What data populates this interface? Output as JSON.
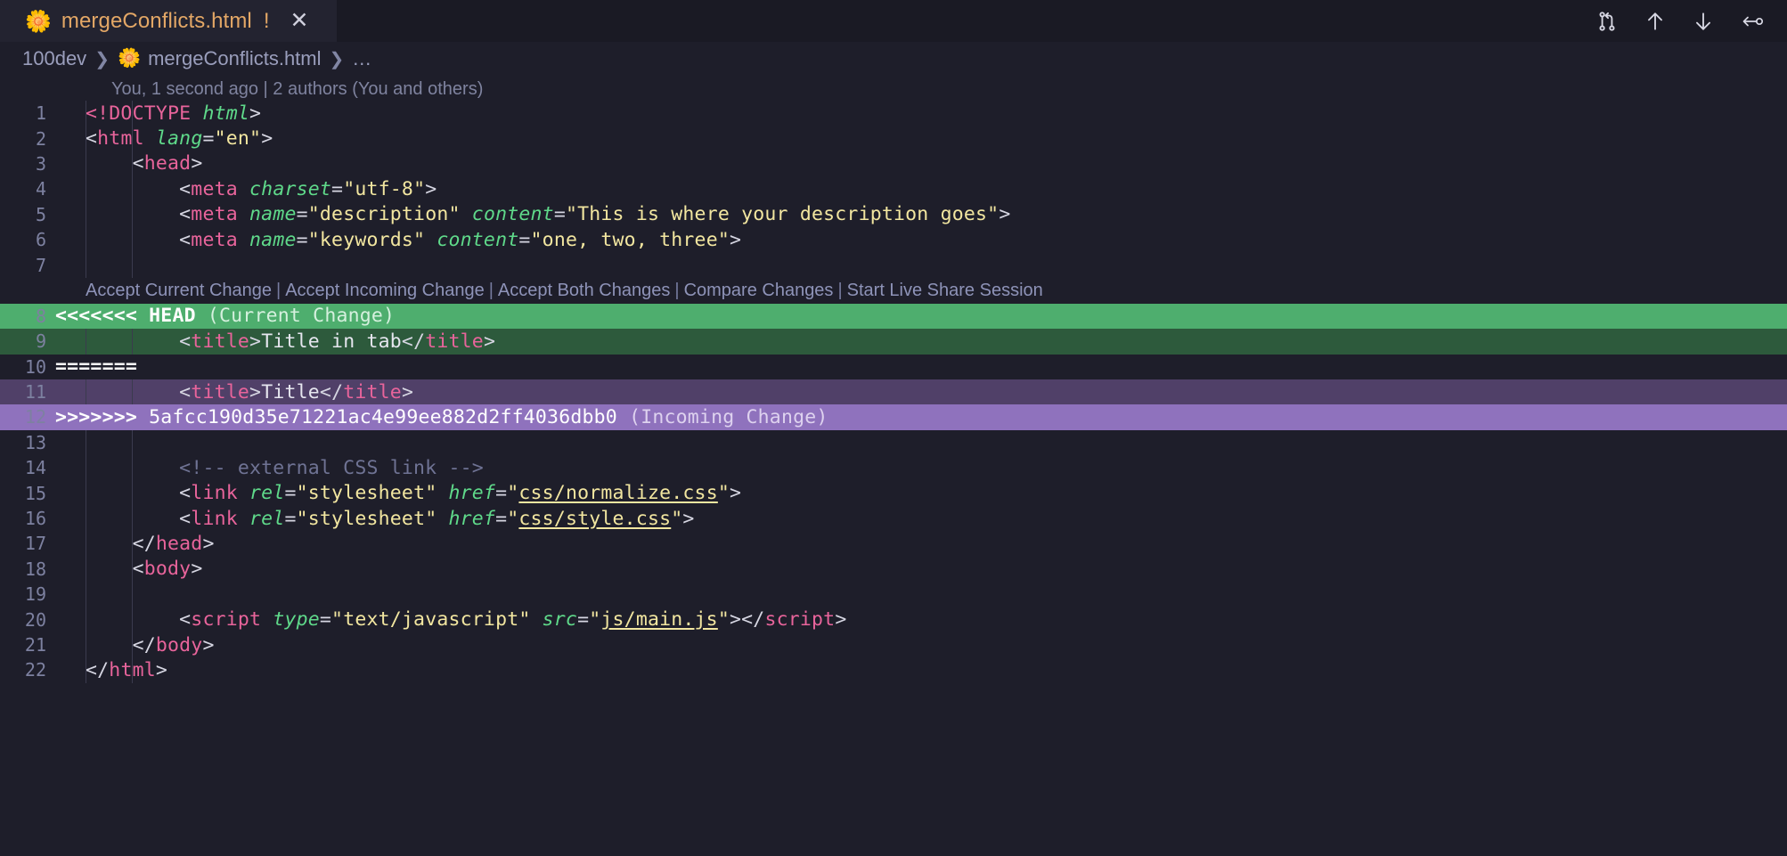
{
  "window": {
    "tab": {
      "icon": "html-file-flower-icon",
      "label": "mergeConflicts.html",
      "dirty_indicator": "!",
      "close": "✕"
    },
    "actions": [
      {
        "name": "compare-changes-icon",
        "title": "Open Changes"
      },
      {
        "name": "arrow-up-icon",
        "title": "Stage Changes"
      },
      {
        "name": "arrow-down-icon",
        "title": "Unstage Changes"
      },
      {
        "name": "discard-changes-icon",
        "title": "Discard Changes"
      }
    ]
  },
  "breadcrumb": {
    "root": "100dev",
    "file": "mergeConflicts.html",
    "more": "…"
  },
  "blame": "You, 1 second ago | 2 authors (You and others)",
  "codelens": {
    "actions": [
      "Accept Current Change",
      "Accept Incoming Change",
      "Accept Both Changes",
      "Compare Changes",
      "Start Live Share Session"
    ],
    "separator": "|"
  },
  "conflict": {
    "current_marker": "<<<<<<<",
    "current_ref": "HEAD",
    "current_label": "(Current Change)",
    "splitter": "=======",
    "incoming_marker": ">>>>>>>",
    "incoming_hash": "5afcc190d35e71221ac4e99ee882d2ff4036dbb0",
    "incoming_label": "(Incoming Change)"
  },
  "colors": {
    "editor_background": "#1e1e2a",
    "tab_active_background": "#232330",
    "tab_label": "#e3a766",
    "current_change_header": "#4eae6e",
    "current_change_body": "#2d5a3c",
    "incoming_change_header": "#8f72bd",
    "incoming_change_body": "#504068",
    "tag": "#e8649b",
    "attribute": "#5fd98a",
    "string": "#f2e6a0",
    "comment": "#6f7394",
    "line_number": "#7d81a0",
    "codelens_link": "#8e93b8"
  },
  "code": {
    "lines": [
      {
        "n": "1",
        "tokens": [
          {
            "t": "<!DOCTYPE ",
            "c": "doct"
          },
          {
            "t": "html",
            "c": "dochtml"
          },
          {
            "t": ">",
            "c": "punc"
          }
        ]
      },
      {
        "n": "2",
        "tokens": [
          {
            "t": "<",
            "c": "punc"
          },
          {
            "t": "html ",
            "c": "tag"
          },
          {
            "t": "lang",
            "c": "attr"
          },
          {
            "t": "=",
            "c": "punc"
          },
          {
            "t": "\"en\"",
            "c": "str"
          },
          {
            "t": ">",
            "c": "punc"
          }
        ]
      },
      {
        "n": "3",
        "tokens": [
          {
            "t": "    <",
            "c": "punc"
          },
          {
            "t": "head",
            "c": "tag"
          },
          {
            "t": ">",
            "c": "punc"
          }
        ]
      },
      {
        "n": "4",
        "tokens": [
          {
            "t": "        <",
            "c": "punc"
          },
          {
            "t": "meta ",
            "c": "tag"
          },
          {
            "t": "charset",
            "c": "attr"
          },
          {
            "t": "=",
            "c": "punc"
          },
          {
            "t": "\"utf-8\"",
            "c": "str"
          },
          {
            "t": ">",
            "c": "punc"
          }
        ]
      },
      {
        "n": "5",
        "tokens": [
          {
            "t": "        <",
            "c": "punc"
          },
          {
            "t": "meta ",
            "c": "tag"
          },
          {
            "t": "name",
            "c": "attr"
          },
          {
            "t": "=",
            "c": "punc"
          },
          {
            "t": "\"description\" ",
            "c": "str"
          },
          {
            "t": "content",
            "c": "attr"
          },
          {
            "t": "=",
            "c": "punc"
          },
          {
            "t": "\"This is where your description goes\"",
            "c": "str"
          },
          {
            "t": ">",
            "c": "punc"
          }
        ]
      },
      {
        "n": "6",
        "tokens": [
          {
            "t": "        <",
            "c": "punc"
          },
          {
            "t": "meta ",
            "c": "tag"
          },
          {
            "t": "name",
            "c": "attr"
          },
          {
            "t": "=",
            "c": "punc"
          },
          {
            "t": "\"keywords\" ",
            "c": "str"
          },
          {
            "t": "content",
            "c": "attr"
          },
          {
            "t": "=",
            "c": "punc"
          },
          {
            "t": "\"one, two, three\"",
            "c": "str"
          },
          {
            "t": ">",
            "c": "punc"
          }
        ]
      },
      {
        "n": "7",
        "tokens": []
      },
      {
        "n": "8",
        "kind": "conflict-current-header"
      },
      {
        "n": "9",
        "kind": "conflict-current-body",
        "tokens": [
          {
            "t": "        <",
            "c": "punc"
          },
          {
            "t": "title",
            "c": "tag"
          },
          {
            "t": ">",
            "c": "punc"
          },
          {
            "t": "Title in tab",
            "c": "text"
          },
          {
            "t": "</",
            "c": "punc"
          },
          {
            "t": "title",
            "c": "tag"
          },
          {
            "t": ">",
            "c": "punc"
          }
        ]
      },
      {
        "n": "10",
        "kind": "conflict-splitter"
      },
      {
        "n": "11",
        "kind": "conflict-incoming-body",
        "tokens": [
          {
            "t": "        <",
            "c": "punc"
          },
          {
            "t": "title",
            "c": "tag"
          },
          {
            "t": ">",
            "c": "punc"
          },
          {
            "t": "Title",
            "c": "text"
          },
          {
            "t": "</",
            "c": "punc"
          },
          {
            "t": "title",
            "c": "tag"
          },
          {
            "t": ">",
            "c": "punc"
          }
        ]
      },
      {
        "n": "12",
        "kind": "conflict-incoming-header"
      },
      {
        "n": "13",
        "tokens": []
      },
      {
        "n": "14",
        "tokens": [
          {
            "t": "        <!-- external CSS link -->",
            "c": "comment"
          }
        ]
      },
      {
        "n": "15",
        "tokens": [
          {
            "t": "        <",
            "c": "punc"
          },
          {
            "t": "link ",
            "c": "tag"
          },
          {
            "t": "rel",
            "c": "attr"
          },
          {
            "t": "=",
            "c": "punc"
          },
          {
            "t": "\"stylesheet\" ",
            "c": "str"
          },
          {
            "t": "href",
            "c": "attr"
          },
          {
            "t": "=",
            "c": "punc"
          },
          {
            "t": "\"",
            "c": "str"
          },
          {
            "t": "css/normalize.css",
            "c": "link"
          },
          {
            "t": "\"",
            "c": "str"
          },
          {
            "t": ">",
            "c": "punc"
          }
        ]
      },
      {
        "n": "16",
        "tokens": [
          {
            "t": "        <",
            "c": "punc"
          },
          {
            "t": "link ",
            "c": "tag"
          },
          {
            "t": "rel",
            "c": "attr"
          },
          {
            "t": "=",
            "c": "punc"
          },
          {
            "t": "\"stylesheet\" ",
            "c": "str"
          },
          {
            "t": "href",
            "c": "attr"
          },
          {
            "t": "=",
            "c": "punc"
          },
          {
            "t": "\"",
            "c": "str"
          },
          {
            "t": "css/style.css",
            "c": "link"
          },
          {
            "t": "\"",
            "c": "str"
          },
          {
            "t": ">",
            "c": "punc"
          }
        ]
      },
      {
        "n": "17",
        "tokens": [
          {
            "t": "    </",
            "c": "punc"
          },
          {
            "t": "head",
            "c": "tag"
          },
          {
            "t": ">",
            "c": "punc"
          }
        ]
      },
      {
        "n": "18",
        "tokens": [
          {
            "t": "    <",
            "c": "punc"
          },
          {
            "t": "body",
            "c": "tag"
          },
          {
            "t": ">",
            "c": "punc"
          }
        ]
      },
      {
        "n": "19",
        "tokens": []
      },
      {
        "n": "20",
        "tokens": [
          {
            "t": "        <",
            "c": "punc"
          },
          {
            "t": "script ",
            "c": "tag"
          },
          {
            "t": "type",
            "c": "attr"
          },
          {
            "t": "=",
            "c": "punc"
          },
          {
            "t": "\"text/javascript\" ",
            "c": "str"
          },
          {
            "t": "src",
            "c": "attr"
          },
          {
            "t": "=",
            "c": "punc"
          },
          {
            "t": "\"",
            "c": "str"
          },
          {
            "t": "js/main.js",
            "c": "link"
          },
          {
            "t": "\"",
            "c": "str"
          },
          {
            "t": ">",
            "c": "punc"
          },
          {
            "t": "</",
            "c": "punc"
          },
          {
            "t": "script",
            "c": "tag"
          },
          {
            "t": ">",
            "c": "punc"
          }
        ]
      },
      {
        "n": "21",
        "tokens": [
          {
            "t": "    </",
            "c": "punc"
          },
          {
            "t": "body",
            "c": "tag"
          },
          {
            "t": ">",
            "c": "punc"
          }
        ]
      },
      {
        "n": "22",
        "tokens": [
          {
            "t": "</",
            "c": "punc"
          },
          {
            "t": "html",
            "c": "tag"
          },
          {
            "t": ">",
            "c": "punc"
          }
        ]
      }
    ]
  }
}
